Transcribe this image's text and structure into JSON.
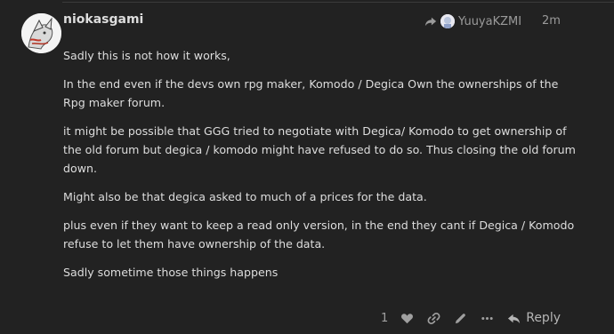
{
  "post": {
    "username": "niokasgami",
    "reply_to_user": "YuuyaKZMI",
    "time": "2m",
    "paragraphs": [
      "Sadly this is not how it works,",
      "In the end even if the devs own rpg maker, Komodo / Degica Own the ownerships of the Rpg maker forum.",
      "it might be possible that GGG tried to negotiate with Degica/ Komodo to get ownership of the old forum but degica / komodo might have refused to do so. Thus closing the old forum down.",
      "Might also be that degica asked to much of a prices for the data.",
      "plus even if they want to keep a read only version, in the end they cant if Degica / Komodo refuse to let them have ownership of the data.",
      "Sadly sometime those things happens"
    ]
  },
  "actions": {
    "like_count": "1",
    "reply_label": "Reply",
    "icons": [
      "heart-icon",
      "link-icon",
      "pencil-icon",
      "ellipsis-icon",
      "reply-arrow-icon"
    ]
  },
  "colors": {
    "background": "#222222",
    "text": "#dddddd",
    "muted": "#9a9a9a"
  }
}
